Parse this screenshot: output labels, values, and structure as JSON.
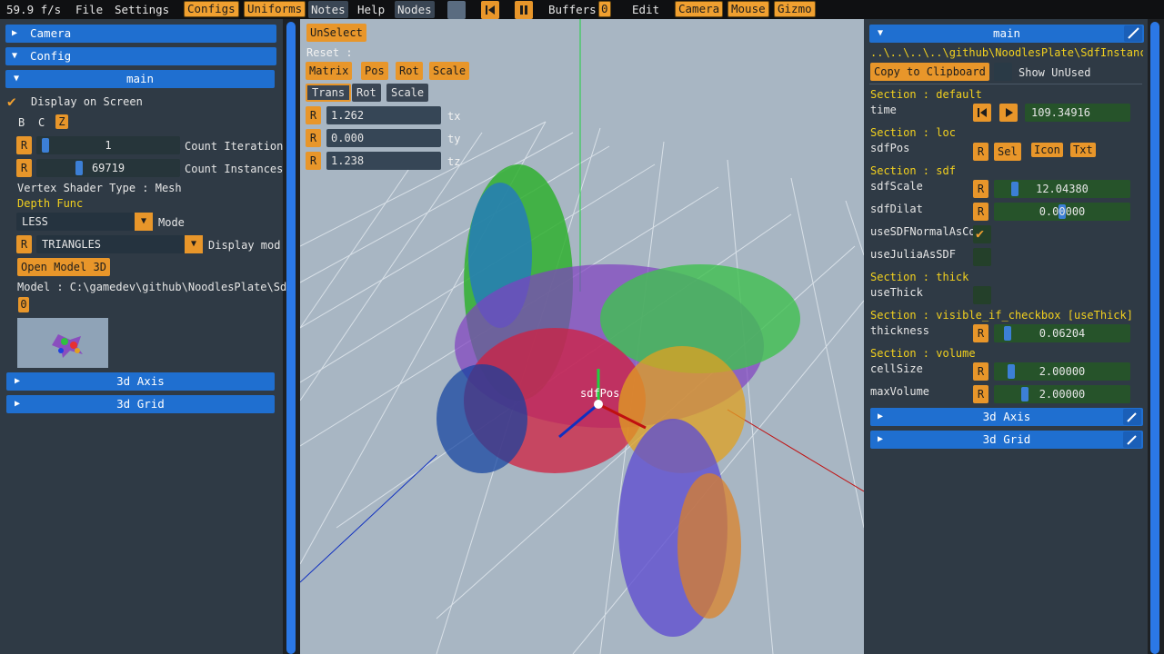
{
  "menubar": {
    "fps": "59.9 f/s",
    "file": "File",
    "settings": "Settings",
    "configs": "Configs",
    "uniforms": "Uniforms",
    "notes": "Notes",
    "help": "Help",
    "nodes": "Nodes",
    "buffers": "Buffers",
    "buffers_count": "0",
    "edit": "Edit",
    "camera": "Camera",
    "mouse": "Mouse",
    "gizmo": "Gizmo"
  },
  "left_panel": {
    "camera_header": "Camera",
    "config_header": "Config",
    "main_header": "main",
    "display_on_screen": "Display on Screen",
    "bcz": [
      "B",
      "C",
      "Z"
    ],
    "count_iteration_value": "1",
    "count_iteration_label": "Count Iteration",
    "count_instances_value": "69719",
    "count_instances_label": "Count Instances",
    "vertex_shader_type": "Vertex Shader Type : Mesh",
    "depth_func": "Depth Func",
    "depth_value": "LESS",
    "mode_label": "Mode",
    "display_mode_value": "TRIANGLES",
    "display_mode_label": "Display mod",
    "open_model_button": "Open Model 3D",
    "model_path": "Model : C:\\gamedev\\github\\NoodlesPlate\\Sd",
    "model_index": "0",
    "axis_header": "3d Axis",
    "grid_header": "3d Grid",
    "reset_label": "R"
  },
  "gizmo": {
    "unselect": "UnSelect",
    "reset": "Reset :",
    "matrix": "Matrix",
    "pos": "Pos",
    "rot": "Rot",
    "scale": "Scale",
    "trans": "Trans",
    "rot2": "Rot",
    "scale2": "Scale",
    "tx_value": "1.262",
    "tx_label": "tx",
    "ty_value": "0.000",
    "ty_label": "ty",
    "tz_value": "1.238",
    "tz_label": "tz",
    "pos_label": "sdfPos"
  },
  "right_panel": {
    "main_header": "main",
    "path": "..\\..\\..\\..\\github\\NoodlesPlate\\SdfInstanci",
    "copy_button": "Copy to Clipboard",
    "show_unused": "Show UnUsed",
    "section_default": "Section : default",
    "time_label": "time",
    "time_value": "109.34916",
    "section_loc": "Section : loc",
    "sdfpos_label": "sdfPos",
    "sel": "Sel",
    "icon": "Icon",
    "txt": "Txt",
    "section_sdf": "Section : sdf",
    "sdfscale_label": "sdfScale",
    "sdfscale_value": "12.04380",
    "sdfdilat_label": "sdfDilat",
    "sdfdilat_value": "0.00000",
    "use_sdf_normal": "useSDFNormalAsCo",
    "use_julia": "useJuliaAsSDF",
    "section_thick": "Section : thick",
    "use_thick": "useThick",
    "section_visible": "Section : visible_if_checkbox [useThick]",
    "thickness_label": "thickness",
    "thickness_value": "0.06204",
    "section_volume": "Section : volume",
    "cellsize_label": "cellSize",
    "cellsize_value": "2.00000",
    "maxvolume_label": "maxVolume",
    "maxvolume_value": "2.00000",
    "axis_header": "3d Axis",
    "grid_header": "3d Grid"
  }
}
